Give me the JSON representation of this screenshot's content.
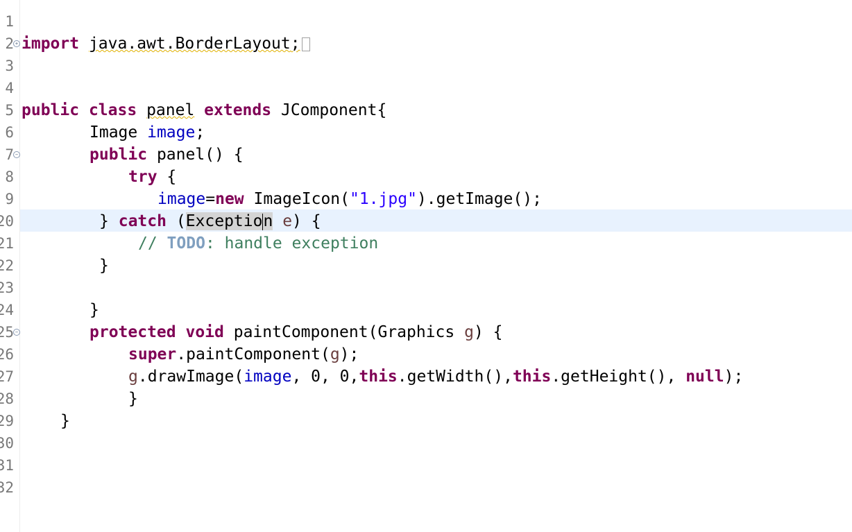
{
  "editor": {
    "line_numbers": [
      "1",
      "2",
      "3",
      "4",
      "5",
      "6",
      "7",
      "8",
      "9",
      "20",
      "21",
      "22",
      "23",
      "24",
      "25",
      "26",
      "27",
      "28",
      "29",
      "30",
      "31",
      "32"
    ],
    "code": {
      "import_kw": "import",
      "import_path": "java.awt.BorderLayout",
      "semicolon": ";",
      "public_kw": "public",
      "class_kw": "class",
      "class_name": "panel",
      "extends_kw": "extends",
      "superclass": "JComponent{",
      "image_type": "Image",
      "image_field": "image",
      "ctor_name": "panel() {",
      "try_kw": "try",
      "open_brace": "{",
      "assign_field": "image",
      "equals": "=",
      "new_kw": "new",
      "imageicon_call": "ImageIcon(",
      "string_literal": "\"1.jpg\"",
      "getimage_call": ").getImage();",
      "close_brace_catch": "}",
      "catch_kw": "catch",
      "catch_open_paren": "(",
      "exception_part1": "Exceptio",
      "exception_part2": "n",
      "catch_param": "e",
      "catch_tail": ") {",
      "comment_slashes": "// ",
      "todo_tag": "TODO",
      "comment_text": ": handle exception",
      "close_brace": "}",
      "protected_kw": "protected",
      "void_kw": "void",
      "paint_sig": "paintComponent(Graphics",
      "g_param": "g",
      "paint_sig_end": ") {",
      "super_kw": "super",
      "super_call": ".paintComponent(",
      "super_call_end": ");",
      "draw_call": ".drawImage(",
      "draw_args_1": ", 0, 0,",
      "this_kw": "this",
      "get_width": ".getWidth(),",
      "get_height": ".getHeight(), ",
      "null_kw": "null",
      "draw_end": ");"
    }
  }
}
